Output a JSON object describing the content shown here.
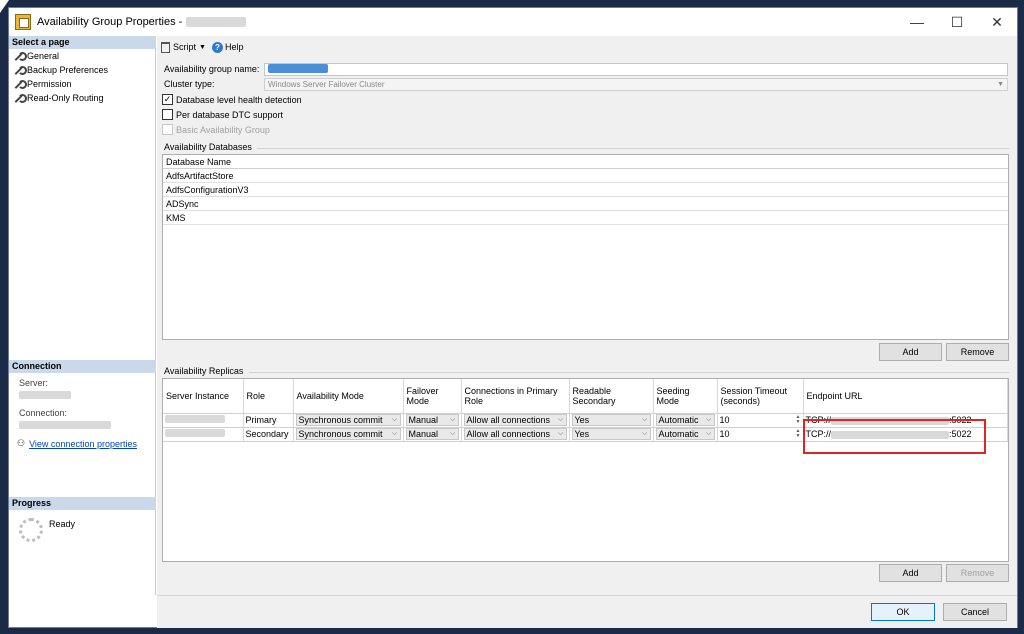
{
  "window": {
    "title": "Availability Group Properties - ",
    "controls": {
      "minimize": "—",
      "maximize": "☐",
      "close": "✕"
    }
  },
  "left": {
    "select_page_header": "Select a page",
    "pages": [
      {
        "label": "General",
        "icon": "wrench-icon"
      },
      {
        "label": "Backup Preferences",
        "icon": "wrench-icon"
      },
      {
        "label": "Permission",
        "icon": "wrench-icon"
      },
      {
        "label": "Read-Only Routing",
        "icon": "wrench-icon"
      }
    ],
    "connection_header": "Connection",
    "server_label": "Server:",
    "connection_label": "Connection:",
    "view_connection_link": "View connection properties",
    "progress_header": "Progress",
    "progress_status": "Ready"
  },
  "toolbar": {
    "script_label": "Script",
    "help_label": "Help"
  },
  "general": {
    "ag_name_label": "Availability group name:",
    "cluster_type_label": "Cluster type:",
    "cluster_type_value": "Windows Server Failover Cluster",
    "db_health_label": "Database level health detection",
    "db_health_checked": true,
    "dtc_label": "Per database DTC support",
    "dtc_checked": false,
    "basic_ag_label": "Basic Availability Group",
    "basic_ag_checked": false
  },
  "databases": {
    "group_label": "Availability Databases",
    "column_header": "Database Name",
    "rows": [
      "AdfsArtifactStore",
      "AdfsConfigurationV3",
      "ADSync",
      "KMS"
    ],
    "add_label": "Add",
    "remove_label": "Remove"
  },
  "replicas": {
    "group_label": "Availability Replicas",
    "columns": [
      "Server Instance",
      "Role",
      "Availability Mode",
      "Failover Mode",
      "Connections in Primary Role",
      "Readable Secondary",
      "Seeding Mode",
      "Session Timeout (seconds)",
      "Endpoint URL"
    ],
    "rows": [
      {
        "role": "Primary",
        "availability_mode": "Synchronous commit",
        "failover_mode": "Manual",
        "connections_primary": "Allow all connections",
        "readable_secondary": "Yes",
        "seeding_mode": "Automatic",
        "session_timeout": "10",
        "endpoint_prefix": "TCP://",
        "endpoint_suffix": ":5022"
      },
      {
        "role": "Secondary",
        "availability_mode": "Synchronous commit",
        "failover_mode": "Manual",
        "connections_primary": "Allow all connections",
        "readable_secondary": "Yes",
        "seeding_mode": "Automatic",
        "session_timeout": "10",
        "endpoint_prefix": "TCP://",
        "endpoint_suffix": ":5022"
      }
    ],
    "add_label": "Add",
    "remove_label": "Remove"
  },
  "footer": {
    "ok_label": "OK",
    "cancel_label": "Cancel"
  },
  "colors": {
    "section_header_bg": "#c9d9ea",
    "highlight_border": "#e02424",
    "link": "#0645ad",
    "desktop": "#1b2b47"
  }
}
